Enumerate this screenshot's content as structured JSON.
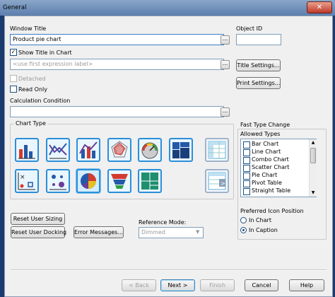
{
  "window": {
    "title": "General",
    "close_label": "✕"
  },
  "fields": {
    "window_title_label": "Window Title",
    "window_title_value": "Product pie chart",
    "object_id_label": "Object ID",
    "object_id_value": "",
    "show_title_label": "Show Title in Chart",
    "show_title_checked": true,
    "title_expression_value": "<use first expression label>",
    "detached_label": "Detached",
    "read_only_label": "Read Only",
    "calc_condition_label": "Calculation Condition",
    "calc_condition_value": ""
  },
  "buttons": {
    "ellipsis": "...",
    "title_settings": "Title Settings...",
    "print_settings": "Print Settings...",
    "reset_user_sizing": "Reset User Sizing",
    "reset_user_docking": "Reset User Docking",
    "error_messages": "Error Messages...",
    "back": "< Back",
    "next": "Next >",
    "finish": "Finish",
    "cancel": "Cancel",
    "help": "Help"
  },
  "chart_type": {
    "label": "Chart Type",
    "icons": [
      "bar-chart-icon",
      "line-chart-icon",
      "combo-chart-icon",
      "radar-chart-icon",
      "gauge-chart-icon",
      "mekko-chart-icon",
      "pivot-table-icon",
      "scatter-chart-icon",
      "grid-chart-icon",
      "pie-chart-icon",
      "funnel-chart-icon",
      "block-chart-icon",
      "straight-table-icon"
    ],
    "selected": "pie-chart-icon"
  },
  "fast_type": {
    "label": "Fast Type Change",
    "allowed_label": "Allowed Types",
    "items": [
      "Bar Chart",
      "Line Chart",
      "Combo Chart",
      "Scatter Chart",
      "Pie Chart",
      "Pivot Table",
      "Straight Table"
    ],
    "icon_position_label": "Preferred Icon Position",
    "icon_position_options": [
      "In Chart",
      "In Caption"
    ],
    "icon_position_selected": "In Caption"
  },
  "reference_mode": {
    "label": "Reference Mode:",
    "value": "Dimmed"
  },
  "colors": {
    "accent": "#2a8fd8",
    "titlebar": "#6f8fbb"
  }
}
